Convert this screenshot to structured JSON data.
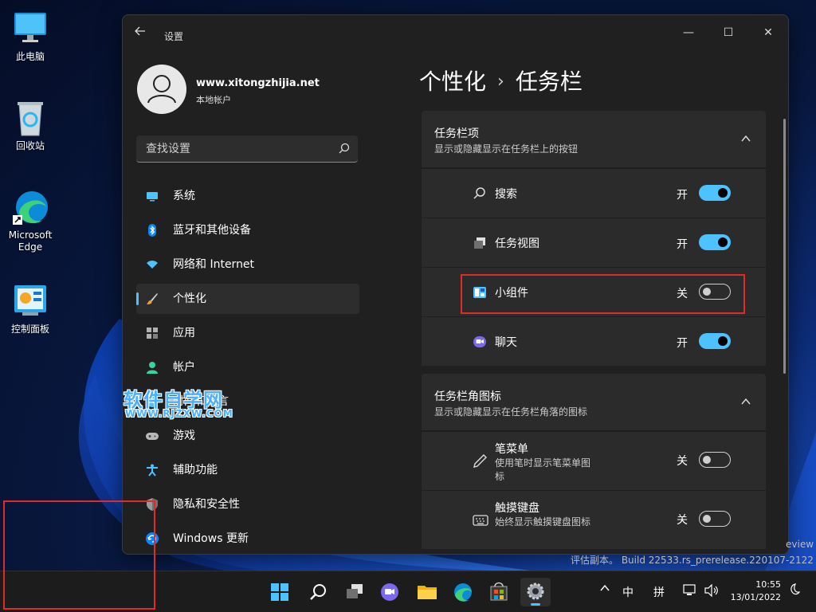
{
  "desktop": {
    "icons": [
      {
        "label": "此电脑"
      },
      {
        "label": "回收站"
      },
      {
        "label": "Microsoft Edge"
      },
      {
        "label": "控制面板"
      }
    ]
  },
  "window": {
    "title": "设置",
    "controls": {
      "minimize": "—",
      "maximize": "☐",
      "close": "✕"
    }
  },
  "profile": {
    "name": "www.xitongzhijia.net",
    "account_type": "本地帐户"
  },
  "search": {
    "placeholder": "查找设置"
  },
  "nav": {
    "items": [
      {
        "label": "系统",
        "icon": "monitor-icon"
      },
      {
        "label": "蓝牙和其他设备",
        "icon": "bluetooth-icon"
      },
      {
        "label": "网络和 Internet",
        "icon": "wifi-icon"
      },
      {
        "label": "个性化",
        "icon": "brush-icon",
        "active": true
      },
      {
        "label": "应用",
        "icon": "apps-icon"
      },
      {
        "label": "帐户",
        "icon": "person-icon"
      },
      {
        "label": "时间和语言",
        "icon": "globe-clock-icon"
      },
      {
        "label": "游戏",
        "icon": "gamepad-icon"
      },
      {
        "label": "辅助功能",
        "icon": "accessibility-icon"
      },
      {
        "label": "隐私和安全性",
        "icon": "shield-icon"
      },
      {
        "label": "Windows 更新",
        "icon": "update-icon"
      }
    ]
  },
  "watermark": {
    "title": "软件自学网",
    "url": "WWW.RJZXW.COM"
  },
  "breadcrumb": {
    "parent": "个性化",
    "separator": "›",
    "current": "任务栏"
  },
  "sections": [
    {
      "title": "任务栏项",
      "subtitle": "显示或隐藏显示在任务栏上的按钮",
      "rows": [
        {
          "label": "搜索",
          "state": "开",
          "on": true,
          "icon": "search-icon"
        },
        {
          "label": "任务视图",
          "state": "开",
          "on": true,
          "icon": "task-view-icon"
        },
        {
          "label": "小组件",
          "state": "关",
          "on": false,
          "icon": "widgets-icon"
        },
        {
          "label": "聊天",
          "state": "开",
          "on": true,
          "icon": "chat-icon"
        }
      ]
    },
    {
      "title": "任务栏角图标",
      "subtitle": "显示或隐藏显示在任务栏角落的图标",
      "rows": [
        {
          "label": "笔菜单",
          "desc": "使用笔时显示笔菜单图标",
          "state": "关",
          "on": false,
          "icon": "pen-icon"
        },
        {
          "label": "触摸键盘",
          "desc": "始终显示触摸键盘图标",
          "state": "关",
          "on": false,
          "icon": "keyboard-icon"
        }
      ]
    }
  ],
  "eval_text": {
    "line1": "eview",
    "line2": "评估副本。 Build 22533.rs_prerelease.220107-2122"
  },
  "taskbar": {
    "apps": [
      "start-icon",
      "search-icon",
      "task-view-icon",
      "chat-icon",
      "file-explorer-icon",
      "edge-icon",
      "store-icon",
      "settings-icon"
    ],
    "tray": {
      "ime_mode": "中",
      "ime_name": "拼",
      "time": "10:55",
      "date": "13/01/2022"
    }
  },
  "colors": {
    "accent": "#4cc2ff",
    "highlight": "#e22a2a",
    "window_bg": "#202020",
    "card_bg": "#2b2b2b"
  }
}
